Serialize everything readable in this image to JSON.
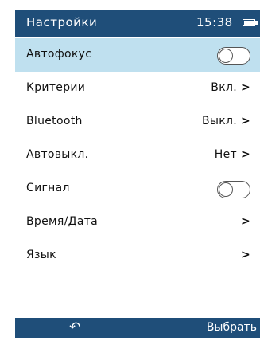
{
  "header": {
    "title": "Настройки",
    "time": "15:38",
    "battery_icon": "battery-icon"
  },
  "menu": {
    "items": [
      {
        "label": "Автофокус",
        "control": "toggle",
        "state": "off",
        "selected": true
      },
      {
        "label": "Критерии",
        "value": "Вкл.",
        "arrow": ">"
      },
      {
        "label": "Bluetooth",
        "value": "Выкл.",
        "arrow": ">"
      },
      {
        "label": "Автовыкл.",
        "value": "Нет",
        "arrow": ">"
      },
      {
        "label": "Сигнал",
        "control": "toggle",
        "state": "off"
      },
      {
        "label": "Время/Дата",
        "value": "",
        "arrow": ">"
      },
      {
        "label": "Язык",
        "value": "",
        "arrow": ">"
      }
    ]
  },
  "footer": {
    "back_icon": "↶",
    "select_label": "Выбрать"
  },
  "colors": {
    "bar": "#1f4e79",
    "selected_row": "#bfe0ef"
  }
}
